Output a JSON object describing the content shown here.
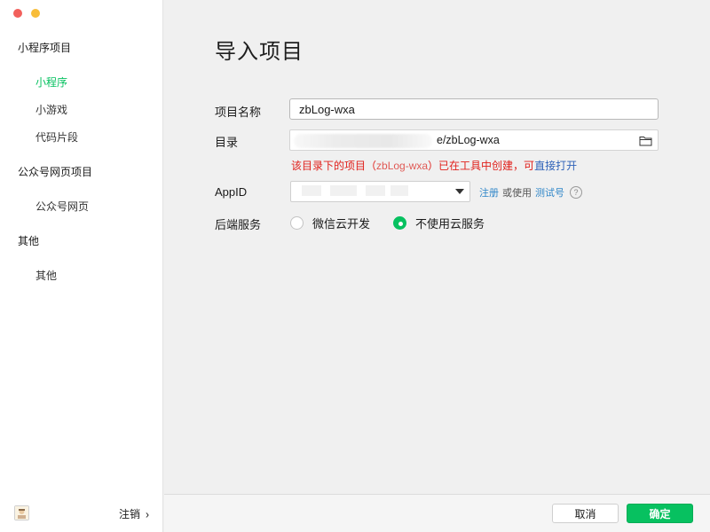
{
  "sidebar": {
    "sections": [
      {
        "title": "小程序项目",
        "items": [
          {
            "label": "小程序",
            "active": true
          },
          {
            "label": "小游戏",
            "active": false
          },
          {
            "label": "代码片段",
            "active": false
          }
        ]
      },
      {
        "title": "公众号网页项目",
        "items": [
          {
            "label": "公众号网页",
            "active": false
          }
        ]
      },
      {
        "title": "其他",
        "items": [
          {
            "label": "其他",
            "active": false
          }
        ]
      }
    ],
    "footer": {
      "logout_label": "注销",
      "chevron": "›"
    }
  },
  "main": {
    "title": "导入项目",
    "form": {
      "name_label": "项目名称",
      "name_value": "zbLog-wxa",
      "dir_label": "目录",
      "dir_value": "e/zbLog-wxa",
      "warning_text": "该目录下的项目（",
      "warning_project": "zbLog-wxa",
      "warning_suffix": "）已在工具中创建，可",
      "warning_link": "直接打开",
      "appid_label": "AppID",
      "appid_register": "注册",
      "appid_or": "或使用",
      "appid_test": "测试号",
      "help_glyph": "?",
      "backend_label": "后端服务",
      "backend_options": [
        {
          "label": "微信云开发",
          "selected": false
        },
        {
          "label": "不使用云服务",
          "selected": true
        }
      ]
    },
    "buttons": {
      "cancel": "取消",
      "confirm": "确定"
    }
  },
  "colors": {
    "accent": "#07c160",
    "warning": "#e0201b",
    "link": "#2f86c8"
  },
  "icons": [
    "folder-icon",
    "chevron-down-icon",
    "help-icon",
    "chevron-right-icon",
    "avatar"
  ]
}
